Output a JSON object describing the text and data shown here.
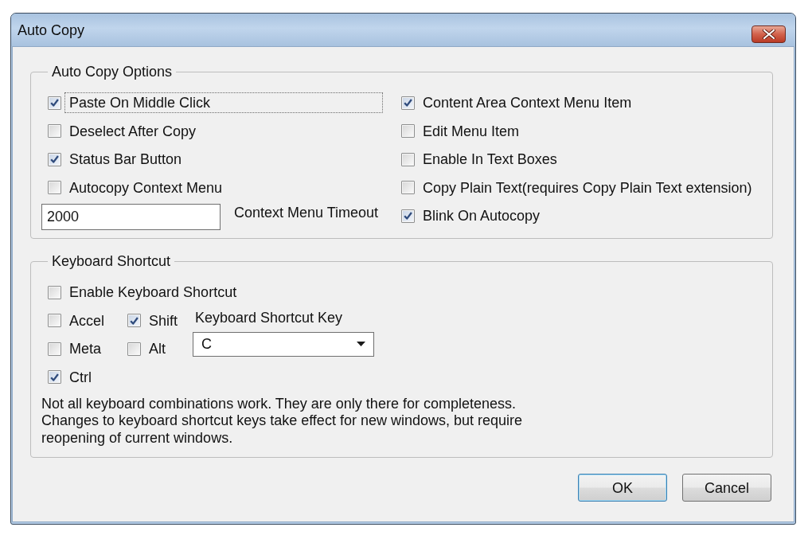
{
  "window": {
    "title": "Auto Copy"
  },
  "auto_copy_options": {
    "title": "Auto Copy Options",
    "left_options": [
      {
        "label": "Paste On Middle Click",
        "checked": true,
        "focused": true
      },
      {
        "label": "Deselect After Copy",
        "checked": false,
        "focused": false
      },
      {
        "label": "Status Bar Button",
        "checked": true,
        "focused": false
      },
      {
        "label": "Autocopy Context Menu",
        "checked": false,
        "focused": false
      }
    ],
    "timeout": {
      "value": "2000",
      "label": "Context Menu Timeout"
    },
    "right_options": [
      {
        "label": "Content Area Context Menu Item",
        "checked": true,
        "focused": false
      },
      {
        "label": "Edit Menu Item",
        "checked": false,
        "focused": false
      },
      {
        "label": "Enable In Text Boxes",
        "checked": false,
        "focused": false
      },
      {
        "label": "Copy Plain Text(requires Copy Plain Text extension)",
        "checked": false,
        "focused": false
      },
      {
        "label": "Blink On Autocopy",
        "checked": true,
        "focused": false
      }
    ]
  },
  "keyboard_shortcut": {
    "title": "Keyboard Shortcut",
    "enable": {
      "label": "Enable Keyboard Shortcut",
      "checked": false,
      "focused": false
    },
    "modifiers": [
      {
        "label": "Accel",
        "checked": false,
        "focused": false
      },
      {
        "label": "Shift",
        "checked": true,
        "focused": false
      },
      {
        "label": "Meta",
        "checked": false,
        "focused": false
      },
      {
        "label": "Alt",
        "checked": false,
        "focused": false
      },
      {
        "label": "Ctrl",
        "checked": true,
        "focused": false
      }
    ],
    "key_label": "Keyboard Shortcut Key",
    "key_select": {
      "value": "C"
    },
    "note": "Not all keyboard combinations work. They are only there for completeness. Changes to keyboard shortcut keys take effect for new windows, but require reopening of current windows."
  },
  "buttons": [
    {
      "label": "OK",
      "default": true
    },
    {
      "label": "Cancel",
      "default": false
    }
  ]
}
